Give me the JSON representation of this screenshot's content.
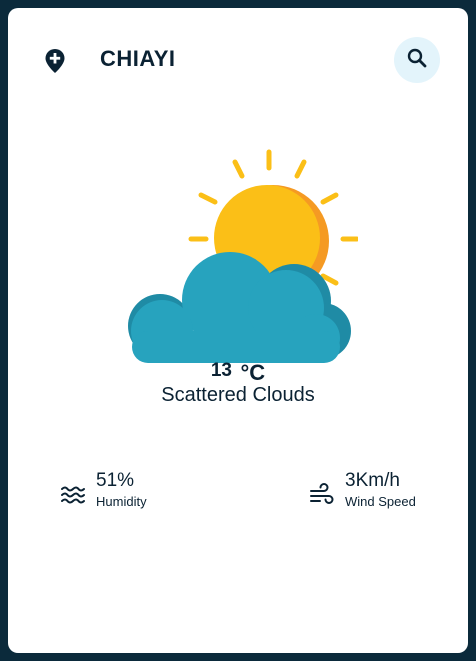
{
  "header": {
    "city": "CHIAYI",
    "add_location_icon": "add-location-icon",
    "search_icon": "search-icon"
  },
  "weather": {
    "icon": "sun-behind-cloud",
    "temperature": "13",
    "unit": "°C",
    "description": "Scattered Clouds"
  },
  "stats": {
    "humidity": {
      "value": "51%",
      "label": "Humidity",
      "icon": "waves-icon"
    },
    "wind": {
      "value": "3Km/h",
      "label": "Wind Speed",
      "icon": "wind-icon"
    }
  },
  "colors": {
    "background": "#0b2a3b",
    "card": "#ffffff",
    "sun": "#fbbf17",
    "cloud": "#27a3be",
    "search_bg": "#e3f4fb"
  }
}
